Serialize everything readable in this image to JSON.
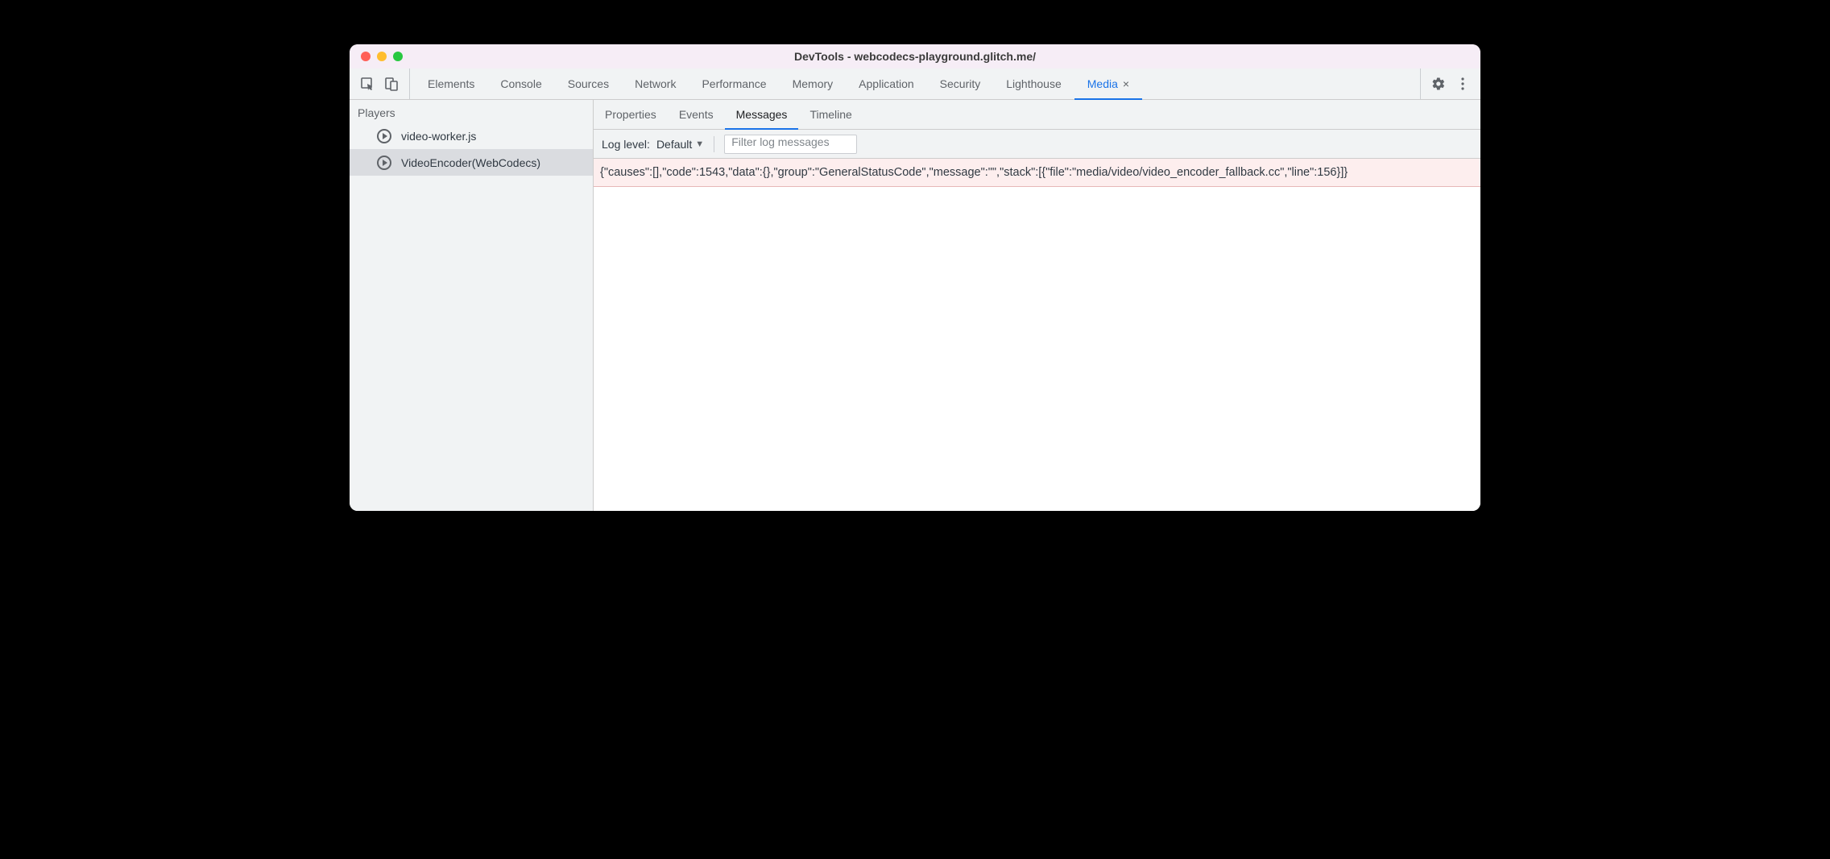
{
  "window": {
    "title": "DevTools - webcodecs-playground.glitch.me/"
  },
  "main_tabs": {
    "items": [
      {
        "label": "Elements",
        "active": false
      },
      {
        "label": "Console",
        "active": false
      },
      {
        "label": "Sources",
        "active": false
      },
      {
        "label": "Network",
        "active": false
      },
      {
        "label": "Performance",
        "active": false
      },
      {
        "label": "Memory",
        "active": false
      },
      {
        "label": "Application",
        "active": false
      },
      {
        "label": "Security",
        "active": false
      },
      {
        "label": "Lighthouse",
        "active": false
      },
      {
        "label": "Media",
        "active": true,
        "closeable": true
      }
    ]
  },
  "sidebar": {
    "header": "Players",
    "items": [
      {
        "label": "video-worker.js",
        "selected": false
      },
      {
        "label": "VideoEncoder(WebCodecs)",
        "selected": true
      }
    ]
  },
  "subtabs": {
    "items": [
      {
        "label": "Properties",
        "active": false
      },
      {
        "label": "Events",
        "active": false
      },
      {
        "label": "Messages",
        "active": true
      },
      {
        "label": "Timeline",
        "active": false
      }
    ]
  },
  "filterbar": {
    "log_level_label": "Log level:",
    "log_level_value": "Default",
    "filter_placeholder": "Filter log messages"
  },
  "log_rows": [
    {
      "text": "{\"causes\":[],\"code\":1543,\"data\":{},\"group\":\"GeneralStatusCode\",\"message\":\"\",\"stack\":[{\"file\":\"media/video/video_encoder_fallback.cc\",\"line\":156}]}",
      "level": "error"
    }
  ]
}
